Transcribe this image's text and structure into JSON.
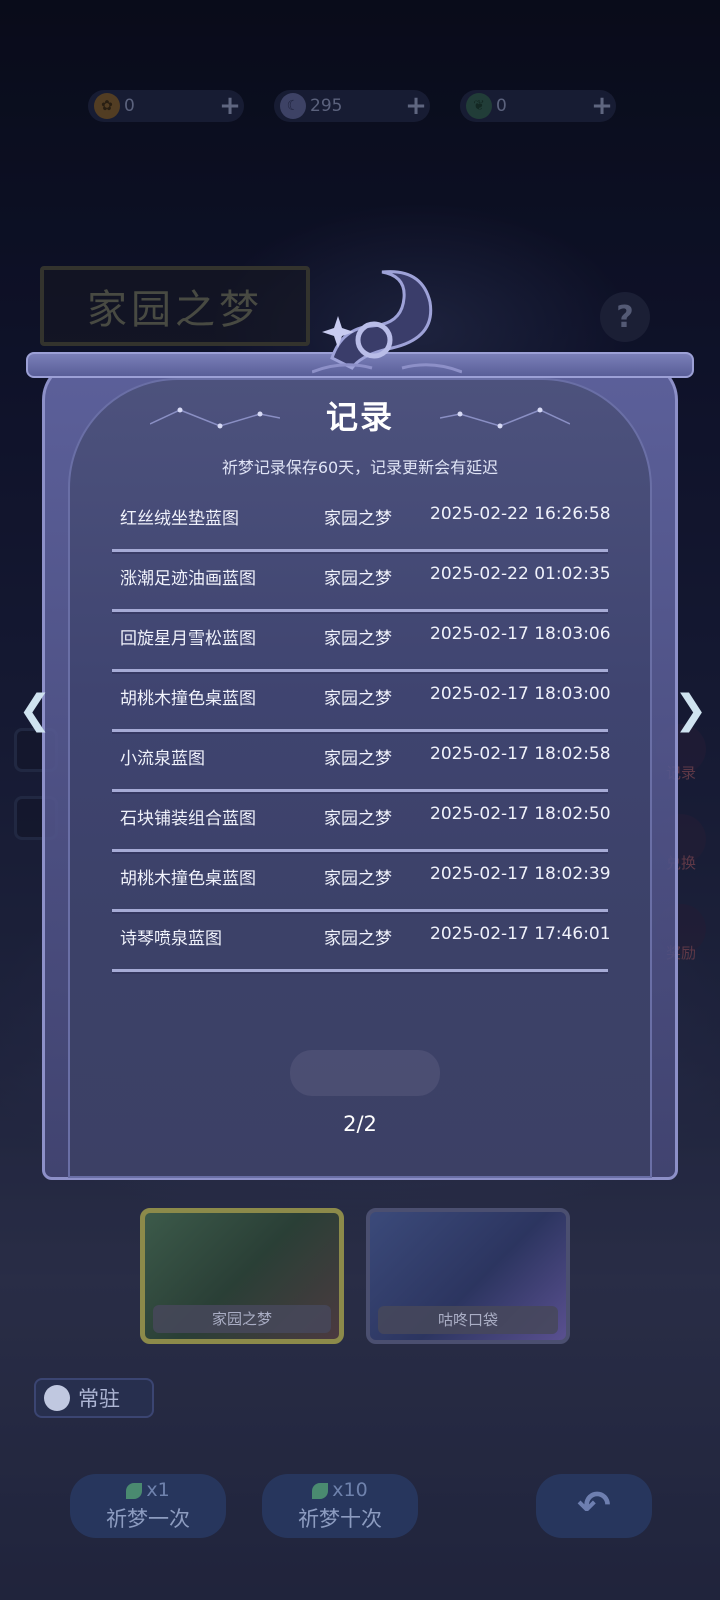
{
  "currency": {
    "coin": {
      "value": "0",
      "icon": "sun-flower-icon"
    },
    "moon": {
      "value": "295",
      "icon": "moon-icon"
    },
    "leaf": {
      "value": "0",
      "icon": "leaf-icon"
    },
    "plus": "+"
  },
  "banner_title": "家园之梦",
  "help_label": "?",
  "panel": {
    "title": "记录",
    "subtitle": "祈梦记录保存60天，记录更新会有延迟",
    "records": [
      {
        "name": "红丝绒坐垫蓝图",
        "pool": "家园之梦",
        "time": "2025-02-22 16:26:58"
      },
      {
        "name": "涨潮足迹油画蓝图",
        "pool": "家园之梦",
        "time": "2025-02-22 01:02:35"
      },
      {
        "name": "回旋星月雪松蓝图",
        "pool": "家园之梦",
        "time": "2025-02-17 18:03:06"
      },
      {
        "name": "胡桃木撞色桌蓝图",
        "pool": "家园之梦",
        "time": "2025-02-17 18:03:00"
      },
      {
        "name": "小流泉蓝图",
        "pool": "家园之梦",
        "time": "2025-02-17 18:02:58"
      },
      {
        "name": "石块铺装组合蓝图",
        "pool": "家园之梦",
        "time": "2025-02-17 18:02:50"
      },
      {
        "name": "胡桃木撞色桌蓝图",
        "pool": "家园之梦",
        "time": "2025-02-17 18:02:39"
      },
      {
        "name": "诗琴喷泉蓝图",
        "pool": "家园之梦",
        "time": "2025-02-17 17:46:01"
      }
    ],
    "page": "2/2",
    "prev": "❮",
    "next": "❯"
  },
  "side": {
    "record_label": "记录",
    "exchange_label": "兑换",
    "reward_label": "奖励"
  },
  "pools": [
    {
      "label": "家园之梦"
    },
    {
      "label": "咕咚口袋"
    }
  ],
  "resident_label": "常驻",
  "bottom": {
    "once": {
      "cost": "x1",
      "label": "祈梦一次"
    },
    "ten": {
      "cost": "x10",
      "label": "祈梦十次"
    },
    "back": "↶"
  },
  "colors": {
    "panel": "#4d527d",
    "divider": "#a6abd6",
    "text": "#f0f2fb"
  }
}
